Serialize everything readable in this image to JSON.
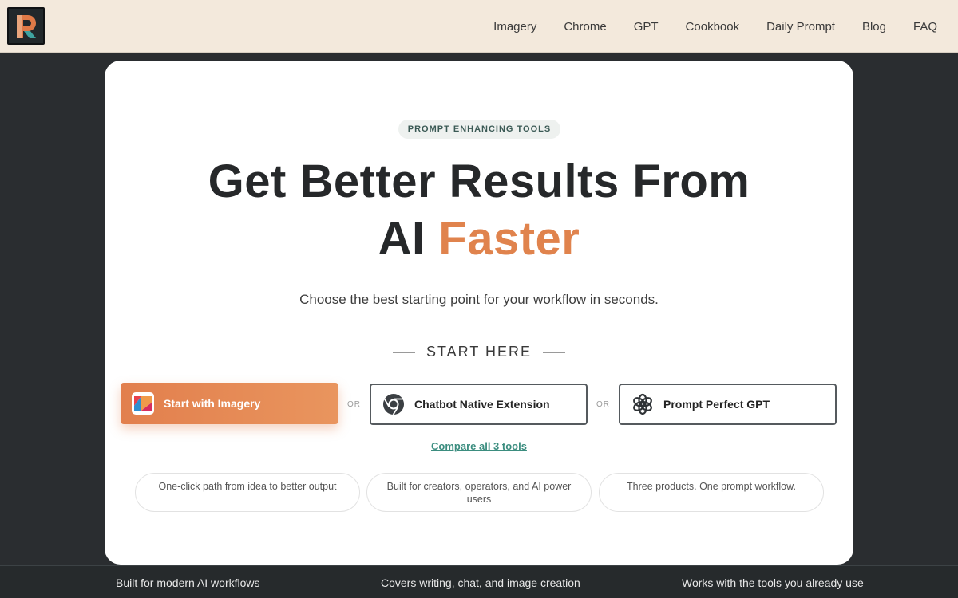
{
  "nav": {
    "items": [
      "Imagery",
      "Chrome",
      "GPT",
      "Cookbook",
      "Daily Prompt",
      "Blog",
      "FAQ"
    ]
  },
  "hero": {
    "badge": "PROMPT ENHANCING TOOLS",
    "headline_line1": "Get Better Results From",
    "headline_line2_plain": "AI",
    "headline_line2_accent": "Faster",
    "subtitle": "Choose the best starting point for your workflow in seconds.",
    "start_label": "START HERE"
  },
  "buttons": {
    "imagery": "Start with Imagery",
    "chrome": "Chatbot Native Extension",
    "gpt": "Prompt Perfect GPT",
    "or": "OR"
  },
  "compare_link": "Compare all 3 tools",
  "features": [
    "One-click path from idea to better output",
    "Built for creators, operators, and AI power users",
    "Three products. One prompt workflow."
  ],
  "footer_strip": [
    "Built for modern AI workflows",
    "Covers writing, chat, and image creation",
    "Works with the tools you already use"
  ],
  "colors": {
    "accent": "#e0834d",
    "link": "#3b8d7f",
    "topbar": "#f3e9dc",
    "background": "#2a2d30"
  }
}
